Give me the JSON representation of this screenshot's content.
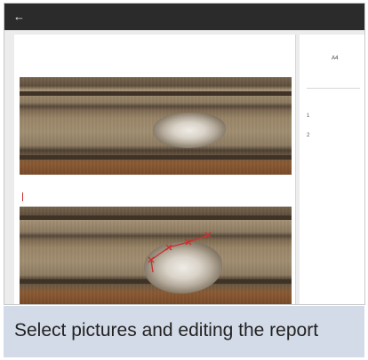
{
  "header": {
    "back_icon": "back-arrow-icon",
    "title": "",
    "right_text": ""
  },
  "report": {
    "caption_1": "",
    "annotation_color": "#c9302c"
  },
  "sidebar": {
    "page_setting_label": "",
    "paper_size_label": "",
    "paper_size_value": "A4",
    "third_label": "",
    "images_label": "",
    "items": [
      {
        "index": "1",
        "name": ""
      },
      {
        "index": "2",
        "name": ""
      }
    ]
  },
  "caption": {
    "text": "Select pictures and editing the report"
  }
}
